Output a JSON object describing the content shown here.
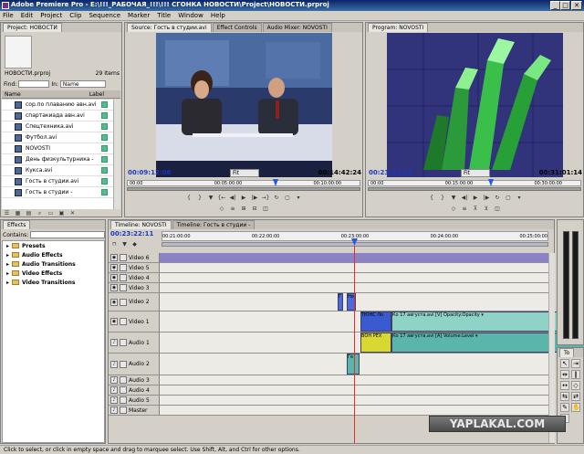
{
  "window": {
    "title": "Adobe Premiere Pro - E:\\!!!_РАБОЧАЯ_!!!\\!!! СГОНКА НОВОСТИ\\Project\\НОВОСТИ.prproj",
    "min": "_",
    "max": "□",
    "close": "✕"
  },
  "menu": [
    "File",
    "Edit",
    "Project",
    "Clip",
    "Sequence",
    "Marker",
    "Title",
    "Window",
    "Help"
  ],
  "project": {
    "tab": "Project: НОВОСТИ",
    "name": "НОВОСТИ.prproj",
    "count": "29 Items",
    "find_label": "Find:",
    "in_label": "In:",
    "in_value": "Name",
    "col_name": "Name",
    "col_label": "Label",
    "items": [
      "сор.по плаванию авн.avi",
      "спартакиада авн.avi",
      "Спецтехника.avi",
      "Футбол.avi",
      "NOVOSTI",
      "День физкультурника -",
      "Кукса.avi",
      "Гость в студии.avi",
      "Гость в студии -"
    ]
  },
  "source": {
    "tabs": [
      "Source: Гость в студии.avi",
      "Effect Controls",
      "Audio Mixer: NOVOSTI"
    ],
    "timecode": "00:09:12:06",
    "fit": "Fit",
    "duration": "00:14:42:24",
    "ruler": [
      "00:00",
      "00:05:00:00",
      "00:10:00:00"
    ]
  },
  "program": {
    "tab": "Program: NOVOSTI",
    "timecode": "00:23:22:11",
    "fit": "Fit",
    "duration": "00:31:01:14",
    "ruler": [
      "00:00",
      "00:15:00:00",
      "00:30:00:00"
    ]
  },
  "effects": {
    "tab": "Effects",
    "contains_label": "Contains:",
    "folders": [
      "Presets",
      "Audio Effects",
      "Audio Transitions",
      "Video Effects",
      "Video Transitions"
    ]
  },
  "timeline": {
    "tabs": [
      "Timeline: NOVOSTI",
      "Timeline: Гость в студии -"
    ],
    "timecode": "00:23:22:11",
    "ruler": [
      "00:21:00:00",
      "00:22:00:00",
      "00:23:00:00",
      "00:24:00:00",
      "00:25:00:00"
    ],
    "tracks": [
      {
        "label": "Video 6",
        "h": 11
      },
      {
        "label": "Video 5",
        "h": 11
      },
      {
        "label": "Video 4",
        "h": 11
      },
      {
        "label": "Video 3",
        "h": 11
      },
      {
        "label": "Video 2",
        "h": 20
      },
      {
        "label": "Video 1",
        "h": 23
      },
      {
        "label": "Audio 1",
        "h": 23
      },
      {
        "label": "Audio 2",
        "h": 24
      },
      {
        "label": "Audio 3",
        "h": 11
      },
      {
        "label": "Audio 4",
        "h": 11
      },
      {
        "label": "Audio 5",
        "h": 11
      },
      {
        "label": "Master",
        "h": 11
      }
    ],
    "clips": {
      "v2a": "Г",
      "v2b": "Не",
      "v1a": "ТЮНС Ло",
      "v1b": "Ко 17 августа.avi [V] Opacity:Opacity ▾",
      "a1a": "ВОН РЕХ",
      "a1b": "Ко 17 августа.avi [A] Volume:Level ▾",
      "a2a": "Ге"
    }
  },
  "tools": {
    "tab": "To"
  },
  "watermark": "YAPLAKAL.COM",
  "status": "Click to select, or click in empty space and drag to marquee select. Use Shift, Alt, and Ctrl for other options.",
  "colors": {
    "accent": "#0a246a",
    "video_track": "#8c82c8",
    "clip_video": "#8fd2c8",
    "clip_audio": "#5ab5aa",
    "playhead": "#e03030"
  }
}
